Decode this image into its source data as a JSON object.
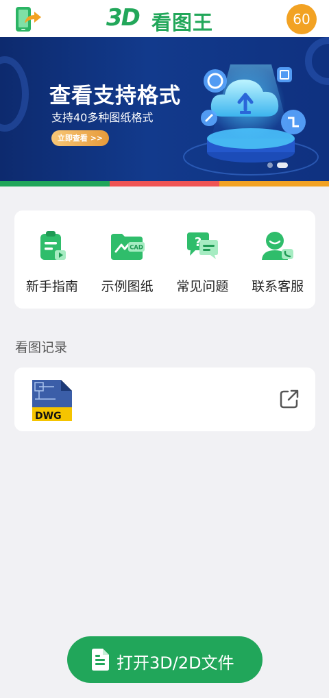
{
  "header": {
    "logo_mark": "3D",
    "logo_text": "看图王",
    "coins": "60",
    "share_icon": "phone-share-icon"
  },
  "banner": {
    "title": "查看支持格式",
    "subtitle": "支持40多种图纸格式",
    "button_label": "立即查看 >>",
    "art_icon": "cloud-upload-icon",
    "slides_total": 2,
    "slide_active_index": 2
  },
  "color_strip": [
    "#21a65a",
    "#ef5454",
    "#f2a223"
  ],
  "quick_actions": [
    {
      "label": "新手指南",
      "icon": "clipboard-guide-icon"
    },
    {
      "label": "示例图纸",
      "icon": "cad-folder-icon"
    },
    {
      "label": "常见问题",
      "icon": "faq-chat-icon"
    },
    {
      "label": "联系客服",
      "icon": "support-agent-icon"
    }
  ],
  "history": {
    "title": "看图记录",
    "items": [
      {
        "file_type": "DWG",
        "file_icon": "dwg-file-icon",
        "action_icon": "open-external-icon"
      }
    ]
  },
  "bottom_button": {
    "label": "打开3D/2D文件",
    "icon": "document-icon"
  },
  "colors": {
    "brand_green": "#21a65a",
    "coin_orange": "#f2a223",
    "banner_blue": "#0f3180",
    "page_bg": "#f1f1f4"
  }
}
